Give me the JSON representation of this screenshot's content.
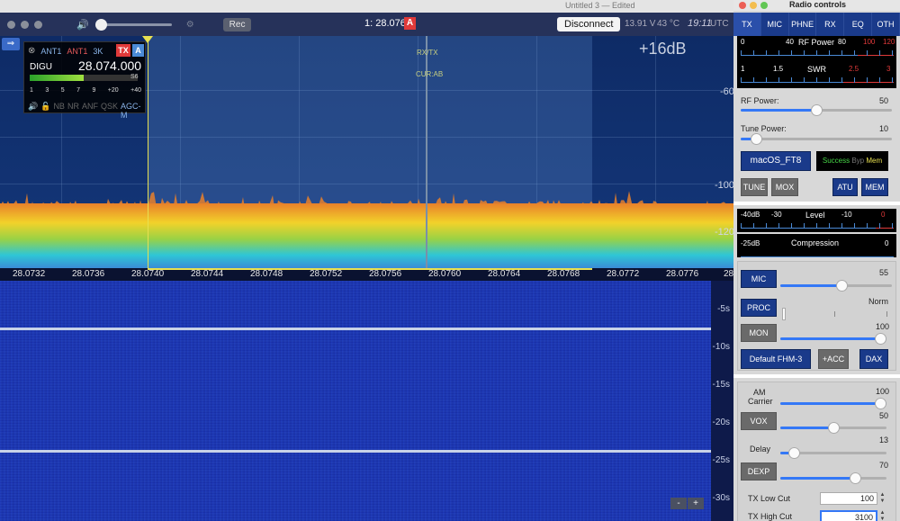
{
  "mac_bar": {
    "title": "Untitled 3 — Edited"
  },
  "sdr": {
    "rec_label": "Rec",
    "center_freq": "1: 28.076",
    "slice_letter": "A",
    "disconnect_label": "Disconnect",
    "status": {
      "voltage": "13.91 V",
      "temperature": "43 °C",
      "time": "19:11",
      "tz": "UTC"
    },
    "db_label": "+16dB",
    "rxtx_label": "RX/TX",
    "curab_label": "CUR:AB",
    "scale": [
      "-60",
      "-100",
      "-120"
    ],
    "slice": {
      "close": "⊗",
      "rx_ant": "ANT1",
      "tx_ant": "ANT1",
      "bandwidth": "3K",
      "tx_badge": "TX",
      "letter": "A",
      "mode": "DIGU",
      "frequency": "28.074.000",
      "s_value": "S6",
      "smeter_level": 0.5,
      "smeter_scale": [
        "1",
        "3",
        "5",
        "7",
        "9",
        "+20",
        "+40"
      ],
      "flags": [
        "NB",
        "NR",
        "ANF",
        "QSK"
      ],
      "agc": "AGC-M"
    },
    "freq_ticks": [
      "28.0732",
      "28.0736",
      "28.0740",
      "28.0744",
      "28.0748",
      "28.0752",
      "28.0756",
      "28.0760",
      "28.0764",
      "28.0768",
      "28.0772",
      "28.0776",
      "28"
    ],
    "wf_times": [
      "-5s",
      "-10s",
      "-15s",
      "-20s",
      "-25s",
      "-30s"
    ],
    "zoom_minus": "-",
    "zoom_plus": "+"
  },
  "radio": {
    "title": "Radio controls",
    "tabs": [
      "TX",
      "MIC",
      "PHNE",
      "RX",
      "EQ",
      "OTH"
    ],
    "rf_meter": {
      "title": "RF Power",
      "left": "0",
      "m1": "40",
      "m2": "80",
      "m3": "100",
      "m4": "120"
    },
    "swr_meter": {
      "title": "SWR",
      "left": "1",
      "m1": "1.5",
      "m2": "2.5",
      "m3": "3"
    },
    "rf_power": {
      "label": "RF Power:",
      "value": "50",
      "level": 0.5
    },
    "tune_power": {
      "label": "Tune Power:",
      "value": "10",
      "level": 0.1
    },
    "profile_btn": "macOS_FT8",
    "atu_status": {
      "success": "Success",
      "byp": "Byp",
      "mem": "Mem"
    },
    "tune_btn": "TUNE",
    "mox_btn": "MOX",
    "atu_btn": "ATU",
    "mem_btn": "MEM",
    "level_meter": {
      "title": "Level",
      "a": "-40dB",
      "b": "-30",
      "c": "-10",
      "d": "0"
    },
    "comp_meter": {
      "title": "Compression",
      "a": "-25dB",
      "b": "0"
    },
    "mic": {
      "label": "MIC",
      "value": "55",
      "level": 0.55
    },
    "proc": {
      "label": "PROC",
      "value": "Norm"
    },
    "mon": {
      "label": "MON",
      "value": "100",
      "level": 1.0
    },
    "mic_profile_btn": "Default FHM-3",
    "acc_btn": "+ACC",
    "dax_btn": "DAX",
    "am_carrier": {
      "label1": "AM",
      "label2": "Carrier",
      "value": "100",
      "level": 1.0
    },
    "vox": {
      "label": "VOX",
      "value": "50",
      "level": 0.5
    },
    "delay": {
      "label": "Delay",
      "value": "13",
      "level": 0.13
    },
    "dexp": {
      "label": "DEXP",
      "value": "70",
      "level": 0.7
    },
    "tx_low_cut": {
      "label": "TX Low Cut",
      "value": "100"
    },
    "tx_high_cut": {
      "label": "TX High Cut",
      "value": "3100"
    }
  }
}
